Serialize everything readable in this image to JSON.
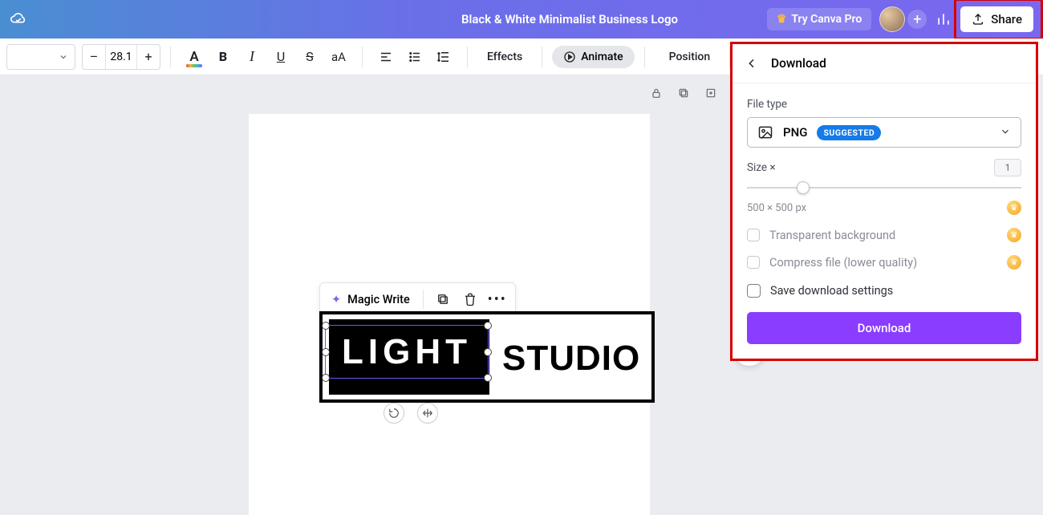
{
  "header": {
    "doc_title": "Black & White Minimalist Business Logo",
    "try_pro": "Try Canva Pro",
    "share": "Share"
  },
  "toolbar": {
    "font_size": "28.1",
    "effects": "Effects",
    "animate": "Animate",
    "position": "Position",
    "text_color_letter": "A",
    "case_letters": "aA",
    "bold_letter": "B",
    "italic_letter": "I",
    "underline_letter": "U",
    "strike_letter": "S"
  },
  "context_bar": {
    "magic_write": "Magic Write"
  },
  "logo": {
    "light": "LIGHT",
    "studio": "STUDIO"
  },
  "panel": {
    "title": "Download",
    "file_type_label": "File type",
    "file_type_value": "PNG",
    "suggested": "SUGGESTED",
    "size_label": "Size ×",
    "size_value": "1",
    "dimensions": "500 × 500 px",
    "transparent": "Transparent background",
    "compress": "Compress file (lower quality)",
    "save_settings": "Save download settings",
    "download_btn": "Download"
  }
}
